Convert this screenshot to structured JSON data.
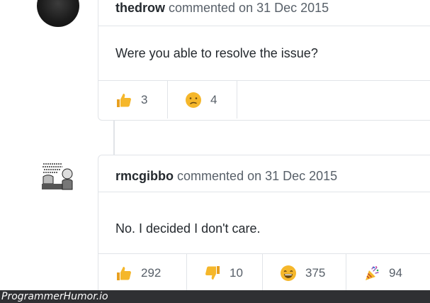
{
  "comments": [
    {
      "author": "thedrow",
      "meta": "commented on 31 Dec 2015",
      "body": "Were you able to resolve the issue?",
      "reactions": [
        {
          "icon": "thumbs-up-icon",
          "count": "3"
        },
        {
          "icon": "confused-face-icon",
          "count": "4"
        }
      ]
    },
    {
      "author": "rmcgibbo",
      "meta": "commented on 31 Dec 2015",
      "body": "No. I decided I don't care.",
      "reactions": [
        {
          "icon": "thumbs-up-icon",
          "count": "292"
        },
        {
          "icon": "thumbs-down-icon",
          "count": "10"
        },
        {
          "icon": "laugh-face-icon",
          "count": "375"
        },
        {
          "icon": "party-popper-icon",
          "count": "94"
        }
      ]
    }
  ],
  "watermark": "ProgrammerHumor.io",
  "colors": {
    "reaction_emoji": "#f5b72b",
    "border": "#e1e4e8",
    "muted_text": "#586069"
  }
}
